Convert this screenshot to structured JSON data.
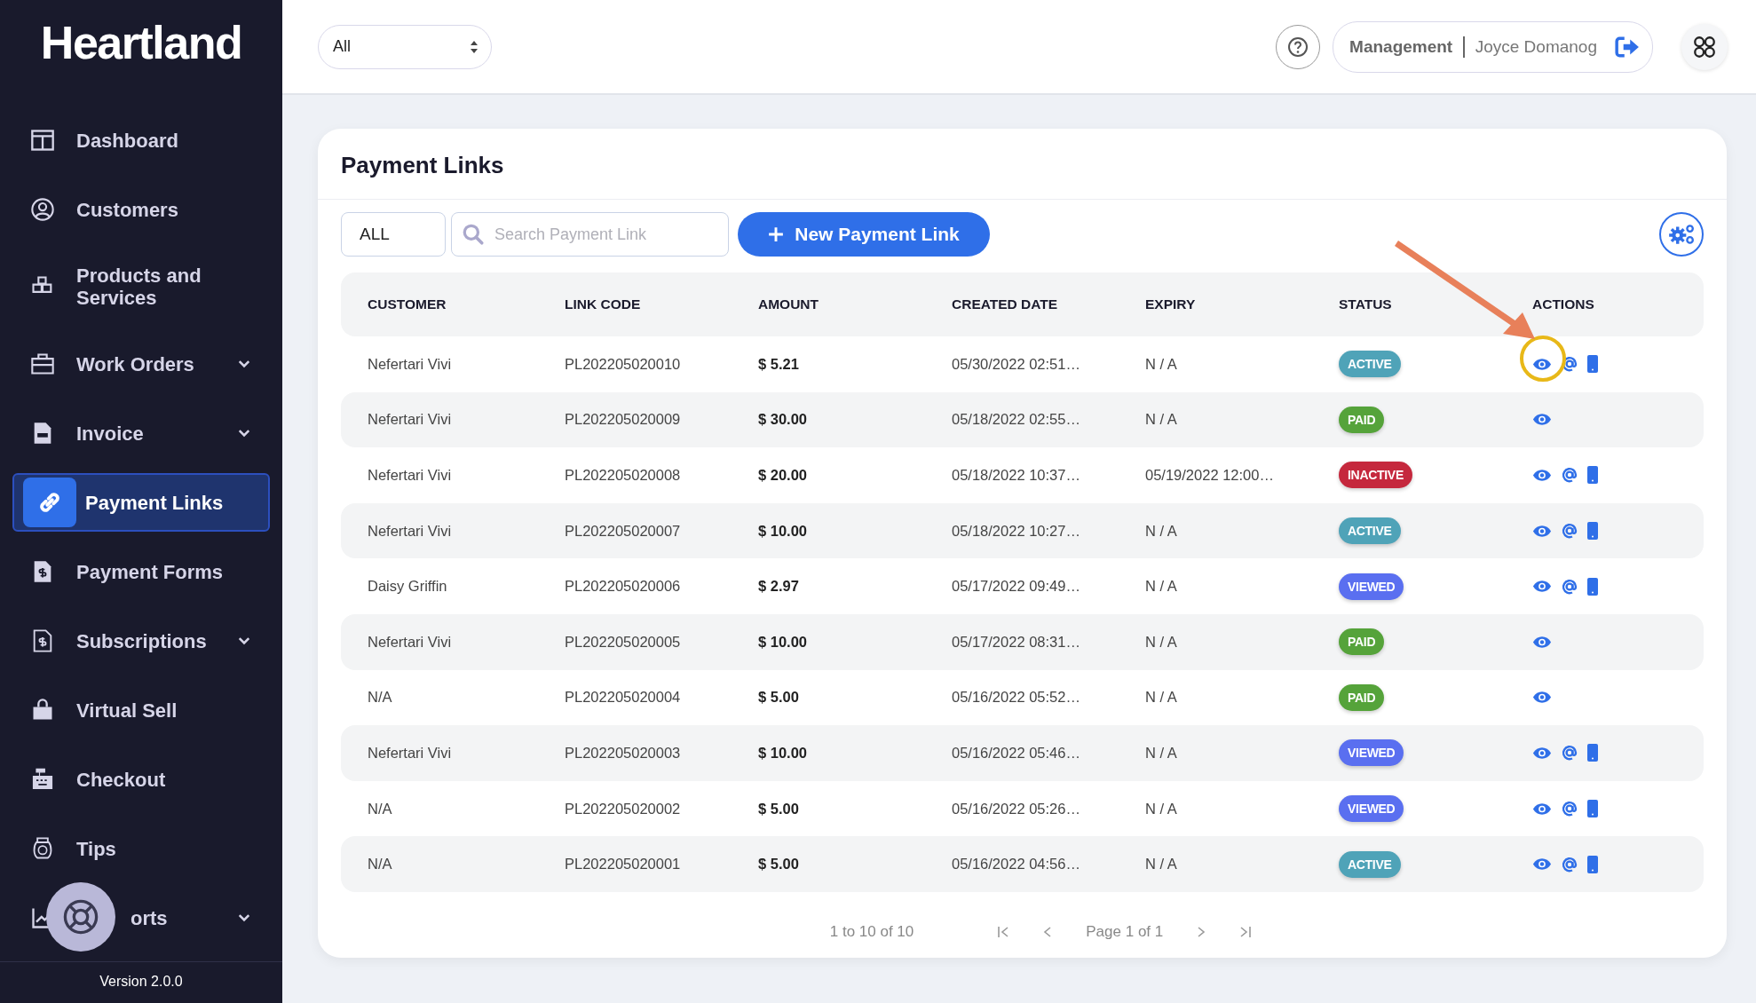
{
  "logo": "Heartland",
  "sidebar": {
    "items": [
      {
        "label": "Dashboard",
        "expandable": false,
        "selected": false
      },
      {
        "label": "Customers",
        "expandable": false,
        "selected": false
      },
      {
        "label": "Products and Services",
        "expandable": false,
        "selected": false
      },
      {
        "label": "Work Orders",
        "expandable": true,
        "selected": false
      },
      {
        "label": "Invoice",
        "expandable": true,
        "selected": false
      },
      {
        "label": "Payment Links",
        "expandable": false,
        "selected": true
      },
      {
        "label": "Payment Forms",
        "expandable": false,
        "selected": false
      },
      {
        "label": "Subscriptions",
        "expandable": true,
        "selected": false
      },
      {
        "label": "Virtual Sell",
        "expandable": false,
        "selected": false
      },
      {
        "label": "Checkout",
        "expandable": false,
        "selected": false
      },
      {
        "label": "Tips",
        "expandable": false,
        "selected": false
      },
      {
        "label": "orts",
        "expandable": true,
        "selected": false
      }
    ],
    "version": "Version 2.0.0"
  },
  "header": {
    "location_select": "All",
    "role": "Management",
    "user": "Joyce Domanog"
  },
  "page": {
    "title": "Payment Links",
    "filter": "ALL",
    "search": {
      "placeholder": "Search Payment Link"
    },
    "new_button": "New Payment Link",
    "table": {
      "columns": [
        "CUSTOMER",
        "LINK CODE",
        "AMOUNT",
        "CREATED DATE",
        "EXPIRY",
        "STATUS",
        "ACTIONS"
      ],
      "rows": [
        {
          "customer": "Nefertari Vivi",
          "code": "PL202205020010",
          "amount": "$ 5.21",
          "created": "05/30/2022 02:51…",
          "expiry": "N / A",
          "status": "ACTIVE",
          "color": "#4fa3b8",
          "actions": [
            {
              "kind": "view"
            },
            {
              "kind": "email"
            },
            {
              "kind": "sms"
            }
          ],
          "highlighted": true
        },
        {
          "customer": "Nefertari Vivi",
          "code": "PL202205020009",
          "amount": "$ 30.00",
          "created": "05/18/2022 02:55…",
          "expiry": "N / A",
          "status": "PAID",
          "color": "#55a33a",
          "actions": [
            {
              "kind": "view"
            }
          ],
          "highlighted": false
        },
        {
          "customer": "Nefertari Vivi",
          "code": "PL202205020008",
          "amount": "$ 20.00",
          "created": "05/18/2022 10:37…",
          "expiry": "05/19/2022 12:00…",
          "status": "INACTIVE",
          "color": "#c5283d",
          "actions": [
            {
              "kind": "view"
            },
            {
              "kind": "email"
            },
            {
              "kind": "sms"
            }
          ],
          "highlighted": false
        },
        {
          "customer": "Nefertari Vivi",
          "code": "PL202205020007",
          "amount": "$ 10.00",
          "created": "05/18/2022 10:27…",
          "expiry": "N / A",
          "status": "ACTIVE",
          "color": "#4fa3b8",
          "actions": [
            {
              "kind": "view"
            },
            {
              "kind": "email"
            },
            {
              "kind": "sms"
            }
          ],
          "highlighted": false
        },
        {
          "customer": "Daisy Griffin",
          "code": "PL202205020006",
          "amount": "$ 2.97",
          "created": "05/17/2022 09:49…",
          "expiry": "N / A",
          "status": "VIEWED",
          "color": "#5a6ff0",
          "actions": [
            {
              "kind": "view"
            },
            {
              "kind": "email"
            },
            {
              "kind": "sms"
            }
          ],
          "highlighted": false
        },
        {
          "customer": "Nefertari Vivi",
          "code": "PL202205020005",
          "amount": "$ 10.00",
          "created": "05/17/2022 08:31…",
          "expiry": "N / A",
          "status": "PAID",
          "color": "#55a33a",
          "actions": [
            {
              "kind": "view"
            }
          ],
          "highlighted": false
        },
        {
          "customer": "N/A",
          "code": "PL202205020004",
          "amount": "$ 5.00",
          "created": "05/16/2022 05:52…",
          "expiry": "N / A",
          "status": "PAID",
          "color": "#55a33a",
          "actions": [
            {
              "kind": "view"
            }
          ],
          "highlighted": false
        },
        {
          "customer": "Nefertari Vivi",
          "code": "PL202205020003",
          "amount": "$ 10.00",
          "created": "05/16/2022 05:46…",
          "expiry": "N / A",
          "status": "VIEWED",
          "color": "#5a6ff0",
          "actions": [
            {
              "kind": "view"
            },
            {
              "kind": "email"
            },
            {
              "kind": "sms"
            }
          ],
          "highlighted": false
        },
        {
          "customer": "N/A",
          "code": "PL202205020002",
          "amount": "$ 5.00",
          "created": "05/16/2022 05:26…",
          "expiry": "N / A",
          "status": "VIEWED",
          "color": "#5a6ff0",
          "actions": [
            {
              "kind": "view"
            },
            {
              "kind": "email"
            },
            {
              "kind": "sms"
            }
          ],
          "highlighted": false
        },
        {
          "customer": "N/A",
          "code": "PL202205020001",
          "amount": "$ 5.00",
          "created": "05/16/2022 04:56…",
          "expiry": "N / A",
          "status": "ACTIVE",
          "color": "#4fa3b8",
          "actions": [
            {
              "kind": "view"
            },
            {
              "kind": "email"
            },
            {
              "kind": "sms"
            }
          ],
          "highlighted": false
        }
      ]
    },
    "pagination": {
      "range": "1 to 10 of 10",
      "page": "Page 1 of 1"
    }
  }
}
